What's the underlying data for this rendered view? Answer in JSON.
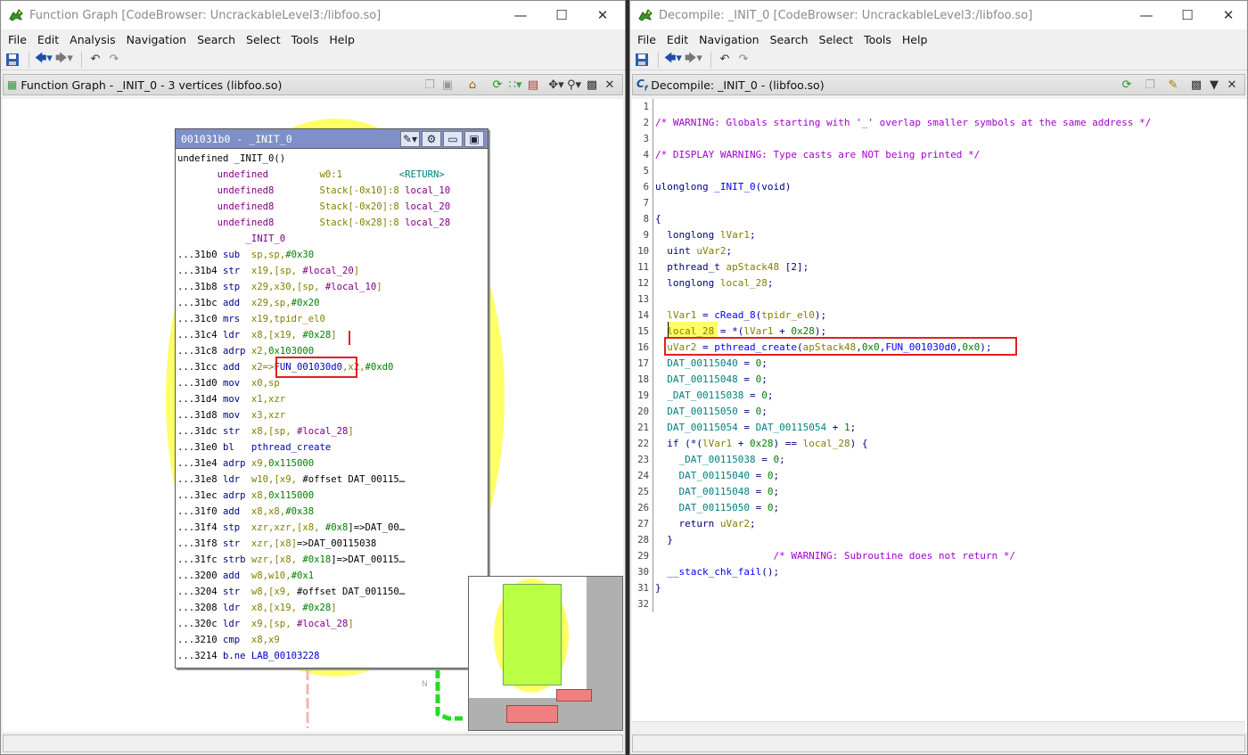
{
  "left_window": {
    "title": "Function Graph [CodeBrowser: UncrackableLevel3:/libfoo.so]",
    "menu": [
      "File",
      "Edit",
      "Analysis",
      "Navigation",
      "Search",
      "Select",
      "Tools",
      "Help"
    ],
    "panel_title": "Function Graph - _INIT_0 - 3 vertices  (libfoo.so)",
    "node_header": "001031b0 - _INIT_0",
    "node_lines": [
      [
        [
          "undefined _INIT_0()",
          "c-addr"
        ]
      ],
      [
        [
          "       undefined         ",
          "c-typ"
        ],
        [
          "w0:1",
          "c-reg"
        ],
        [
          "          <RETURN>",
          "c-ret"
        ]
      ],
      [
        [
          "       undefined8        ",
          "c-typ"
        ],
        [
          "Stack[-0x10]:8 ",
          "c-reg"
        ],
        [
          "local_10",
          "c-var"
        ]
      ],
      [
        [
          "       undefined8        ",
          "c-typ"
        ],
        [
          "Stack[-0x20]:8 ",
          "c-reg"
        ],
        [
          "local_20",
          "c-var"
        ]
      ],
      [
        [
          "       undefined8        ",
          "c-typ"
        ],
        [
          "Stack[-0x28]:8 ",
          "c-reg"
        ],
        [
          "local_28",
          "c-var"
        ]
      ],
      [
        [
          "            _INIT_0",
          "c-var"
        ]
      ],
      [
        [
          "...31b0 ",
          "c-addr"
        ],
        [
          "sub  ",
          "c-mn"
        ],
        [
          "sp,sp,",
          "c-reg"
        ],
        [
          "#0x30",
          "c-num"
        ]
      ],
      [
        [
          "...31b4 ",
          "c-addr"
        ],
        [
          "str  ",
          "c-mn"
        ],
        [
          "x19,[sp, ",
          "c-reg"
        ],
        [
          "#local_20",
          "c-var"
        ],
        [
          "]",
          "c-reg"
        ]
      ],
      [
        [
          "...31b8 ",
          "c-addr"
        ],
        [
          "stp  ",
          "c-mn"
        ],
        [
          "x29,x30,[sp, ",
          "c-reg"
        ],
        [
          "#local_10",
          "c-var"
        ],
        [
          "]",
          "c-reg"
        ]
      ],
      [
        [
          "...31bc ",
          "c-addr"
        ],
        [
          "add  ",
          "c-mn"
        ],
        [
          "x29,sp,",
          "c-reg"
        ],
        [
          "#0x20",
          "c-num"
        ]
      ],
      [
        [
          "...31c0 ",
          "c-addr"
        ],
        [
          "mrs  ",
          "c-mn"
        ],
        [
          "x19,tpidr_el0",
          "c-reg"
        ]
      ],
      [
        [
          "...31c4 ",
          "c-addr"
        ],
        [
          "ldr  ",
          "c-mn"
        ],
        [
          "x8,[x19, ",
          "c-reg"
        ],
        [
          "#0x28",
          "c-num"
        ],
        [
          "]",
          "c-reg"
        ]
      ],
      [
        [
          "...31c8 ",
          "c-addr"
        ],
        [
          "adrp ",
          "c-mn"
        ],
        [
          "x2,",
          "c-reg"
        ],
        [
          "0x103000",
          "c-num"
        ]
      ],
      [
        [
          "...31cc ",
          "c-addr"
        ],
        [
          "add  ",
          "c-mn"
        ],
        [
          "x2=>",
          "c-reg"
        ],
        [
          "FUN_001030d0",
          "c-lab"
        ],
        [
          ",x2,",
          "c-reg"
        ],
        [
          "#0xd0",
          "c-num"
        ]
      ],
      [
        [
          "...31d0 ",
          "c-addr"
        ],
        [
          "mov  ",
          "c-mn"
        ],
        [
          "x0,sp",
          "c-reg"
        ]
      ],
      [
        [
          "...31d4 ",
          "c-addr"
        ],
        [
          "mov  ",
          "c-mn"
        ],
        [
          "x1,xzr",
          "c-reg"
        ]
      ],
      [
        [
          "...31d8 ",
          "c-addr"
        ],
        [
          "mov  ",
          "c-mn"
        ],
        [
          "x3,xzr",
          "c-reg"
        ]
      ],
      [
        [
          "...31dc ",
          "c-addr"
        ],
        [
          "str  ",
          "c-mn"
        ],
        [
          "x8,[sp, ",
          "c-reg"
        ],
        [
          "#local_28",
          "c-var"
        ],
        [
          "]",
          "c-reg"
        ]
      ],
      [
        [
          "...31e0 ",
          "c-addr"
        ],
        [
          "bl   ",
          "c-mn"
        ],
        [
          "pthread_create",
          "c-fn"
        ]
      ],
      [
        [
          "...31e4 ",
          "c-addr"
        ],
        [
          "adrp ",
          "c-mn"
        ],
        [
          "x9,",
          "c-reg"
        ],
        [
          "0x115000",
          "c-num"
        ]
      ],
      [
        [
          "...31e8 ",
          "c-addr"
        ],
        [
          "ldr  ",
          "c-mn"
        ],
        [
          "w10,[x9, ",
          "c-reg"
        ],
        [
          "#offset DAT_00115…",
          "c-addr"
        ]
      ],
      [
        [
          "...31ec ",
          "c-addr"
        ],
        [
          "adrp ",
          "c-mn"
        ],
        [
          "x8,",
          "c-reg"
        ],
        [
          "0x115000",
          "c-num"
        ]
      ],
      [
        [
          "...31f0 ",
          "c-addr"
        ],
        [
          "add  ",
          "c-mn"
        ],
        [
          "x8,x8,",
          "c-reg"
        ],
        [
          "#0x38",
          "c-num"
        ]
      ],
      [
        [
          "...31f4 ",
          "c-addr"
        ],
        [
          "stp  ",
          "c-mn"
        ],
        [
          "xzr,xzr,[x8, ",
          "c-reg"
        ],
        [
          "#0x8",
          "c-num"
        ],
        [
          "]=>DAT_00…",
          "c-addr"
        ]
      ],
      [
        [
          "...31f8 ",
          "c-addr"
        ],
        [
          "str  ",
          "c-mn"
        ],
        [
          "xzr,[x8]",
          "c-reg"
        ],
        [
          "=>DAT_00115038",
          "c-addr"
        ]
      ],
      [
        [
          "...31fc ",
          "c-addr"
        ],
        [
          "strb ",
          "c-mn"
        ],
        [
          "wzr,[x8, ",
          "c-reg"
        ],
        [
          "#0x18",
          "c-num"
        ],
        [
          "]=>DAT_00115…",
          "c-addr"
        ]
      ],
      [
        [
          "...3200 ",
          "c-addr"
        ],
        [
          "add  ",
          "c-mn"
        ],
        [
          "w8,w10,",
          "c-reg"
        ],
        [
          "#0x1",
          "c-num"
        ]
      ],
      [
        [
          "...3204 ",
          "c-addr"
        ],
        [
          "str  ",
          "c-mn"
        ],
        [
          "w8,[x9, ",
          "c-reg"
        ],
        [
          "#offset DAT_001150…",
          "c-addr"
        ]
      ],
      [
        [
          "...3208 ",
          "c-addr"
        ],
        [
          "ldr  ",
          "c-mn"
        ],
        [
          "x8,[x19, ",
          "c-reg"
        ],
        [
          "#0x28",
          "c-num"
        ],
        [
          "]",
          "c-reg"
        ]
      ],
      [
        [
          "...320c ",
          "c-addr"
        ],
        [
          "ldr  ",
          "c-mn"
        ],
        [
          "x9,[sp, ",
          "c-reg"
        ],
        [
          "#local_28",
          "c-var"
        ],
        [
          "]",
          "c-reg"
        ]
      ],
      [
        [
          "...3210 ",
          "c-addr"
        ],
        [
          "cmp  ",
          "c-mn"
        ],
        [
          "x8,x9",
          "c-reg"
        ]
      ],
      [
        [
          "...3214 ",
          "c-addr"
        ],
        [
          "b.ne ",
          "c-mn"
        ],
        [
          "LAB_00103228",
          "c-lab"
        ]
      ]
    ],
    "edge_label": "N"
  },
  "right_window": {
    "title": "Decompile: _INIT_0 [CodeBrowser: UncrackableLevel3:/libfoo.so]",
    "menu": [
      "File",
      "Edit",
      "Navigation",
      "Search",
      "Select",
      "Tools",
      "Help"
    ],
    "panel_title": "Decompile: _INIT_0 -  (libfoo.so)",
    "code_lines": [
      [],
      [
        [
          "/* WARNING: Globals starting with '_' overlap smaller symbols at the same address */",
          "k-cm"
        ]
      ],
      [],
      [
        [
          "/* DISPLAY WARNING: Type casts are NOT being printed */",
          "k-cm"
        ]
      ],
      [],
      [
        [
          "ulonglong ",
          "k-ty"
        ],
        [
          "_INIT_0",
          "k-fn"
        ],
        [
          "(void)",
          "k-ty"
        ]
      ],
      [],
      [
        [
          "{",
          "k-ty"
        ]
      ],
      [
        [
          "  longlong ",
          "k-ty"
        ],
        [
          "lVar1",
          "k-var"
        ],
        [
          ";",
          "k-ty"
        ]
      ],
      [
        [
          "  uint ",
          "k-ty"
        ],
        [
          "uVar2",
          "k-var"
        ],
        [
          ";",
          "k-ty"
        ]
      ],
      [
        [
          "  pthread_t ",
          "k-ty"
        ],
        [
          "apStack48",
          "k-var"
        ],
        [
          " [2];",
          "k-ty"
        ]
      ],
      [
        [
          "  longlong ",
          "k-ty"
        ],
        [
          "local_28",
          "k-var"
        ],
        [
          ";",
          "k-ty"
        ]
      ],
      [],
      [
        [
          "  lVar1",
          "k-var"
        ],
        [
          " = ",
          "k-ty"
        ],
        [
          "cRead_8",
          "k-fn"
        ],
        [
          "(",
          "k-ty"
        ],
        [
          "tpidr_el0",
          "k-var"
        ],
        [
          ");",
          "k-ty"
        ]
      ],
      [
        [
          "  local_28",
          "k-var"
        ],
        [
          " = *(",
          "k-ty"
        ],
        [
          "lVar1",
          "k-var"
        ],
        [
          " + ",
          "k-ty"
        ],
        [
          "0x28",
          "k-num"
        ],
        [
          ");",
          "k-ty"
        ]
      ],
      [
        [
          "  uVar2",
          "k-var"
        ],
        [
          " = ",
          "k-ty"
        ],
        [
          "pthread_create",
          "k-fn"
        ],
        [
          "(",
          "k-ty"
        ],
        [
          "apStack48",
          "k-var"
        ],
        [
          ",",
          "k-ty"
        ],
        [
          "0x0",
          "k-num"
        ],
        [
          ",",
          "k-ty"
        ],
        [
          "FUN_001030d0",
          "k-fn"
        ],
        [
          ",",
          "k-ty"
        ],
        [
          "0x0",
          "k-num"
        ],
        [
          ");",
          "k-ty"
        ]
      ],
      [
        [
          "  DAT_00115040",
          "k-dat"
        ],
        [
          " = ",
          "k-ty"
        ],
        [
          "0",
          "k-num"
        ],
        [
          ";",
          "k-ty"
        ]
      ],
      [
        [
          "  DAT_00115048",
          "k-dat"
        ],
        [
          " = ",
          "k-ty"
        ],
        [
          "0",
          "k-num"
        ],
        [
          ";",
          "k-ty"
        ]
      ],
      [
        [
          "  _DAT_00115038",
          "k-dat"
        ],
        [
          " = ",
          "k-ty"
        ],
        [
          "0",
          "k-num"
        ],
        [
          ";",
          "k-ty"
        ]
      ],
      [
        [
          "  DAT_00115050",
          "k-dat"
        ],
        [
          " = ",
          "k-ty"
        ],
        [
          "0",
          "k-num"
        ],
        [
          ";",
          "k-ty"
        ]
      ],
      [
        [
          "  DAT_00115054",
          "k-dat"
        ],
        [
          " = ",
          "k-ty"
        ],
        [
          "DAT_00115054",
          "k-dat"
        ],
        [
          " + ",
          "k-ty"
        ],
        [
          "1",
          "k-num"
        ],
        [
          ";",
          "k-ty"
        ]
      ],
      [
        [
          "  if ",
          "k-kw"
        ],
        [
          "(*(",
          "k-ty"
        ],
        [
          "lVar1",
          "k-var"
        ],
        [
          " + ",
          "k-ty"
        ],
        [
          "0x28",
          "k-num"
        ],
        [
          ") == ",
          "k-ty"
        ],
        [
          "local_28",
          "k-var"
        ],
        [
          ") {",
          "k-ty"
        ]
      ],
      [
        [
          "    _DAT_00115038",
          "k-dat"
        ],
        [
          " = ",
          "k-ty"
        ],
        [
          "0",
          "k-num"
        ],
        [
          ";",
          "k-ty"
        ]
      ],
      [
        [
          "    DAT_00115040",
          "k-dat"
        ],
        [
          " = ",
          "k-ty"
        ],
        [
          "0",
          "k-num"
        ],
        [
          ";",
          "k-ty"
        ]
      ],
      [
        [
          "    DAT_00115048",
          "k-dat"
        ],
        [
          " = ",
          "k-ty"
        ],
        [
          "0",
          "k-num"
        ],
        [
          ";",
          "k-ty"
        ]
      ],
      [
        [
          "    DAT_00115050",
          "k-dat"
        ],
        [
          " = ",
          "k-ty"
        ],
        [
          "0",
          "k-num"
        ],
        [
          ";",
          "k-ty"
        ]
      ],
      [
        [
          "    return ",
          "k-kw"
        ],
        [
          "uVar2",
          "k-var"
        ],
        [
          ";",
          "k-ty"
        ]
      ],
      [
        [
          "  }",
          "k-ty"
        ]
      ],
      [
        [
          "                    /* WARNING: Subroutine does not return */",
          "k-cm"
        ]
      ],
      [
        [
          "  __stack_chk_fail",
          "k-fn"
        ],
        [
          "();",
          "k-ty"
        ]
      ],
      [
        [
          "}",
          "k-ty"
        ]
      ],
      []
    ]
  },
  "colors": {
    "graph_blob": "#ffff66",
    "node_header": "#7f90c8",
    "highlight_box": "#e02020",
    "minimap_node": "#bbff44",
    "minimap_child": "#f08080",
    "edge": "#22cc22"
  }
}
